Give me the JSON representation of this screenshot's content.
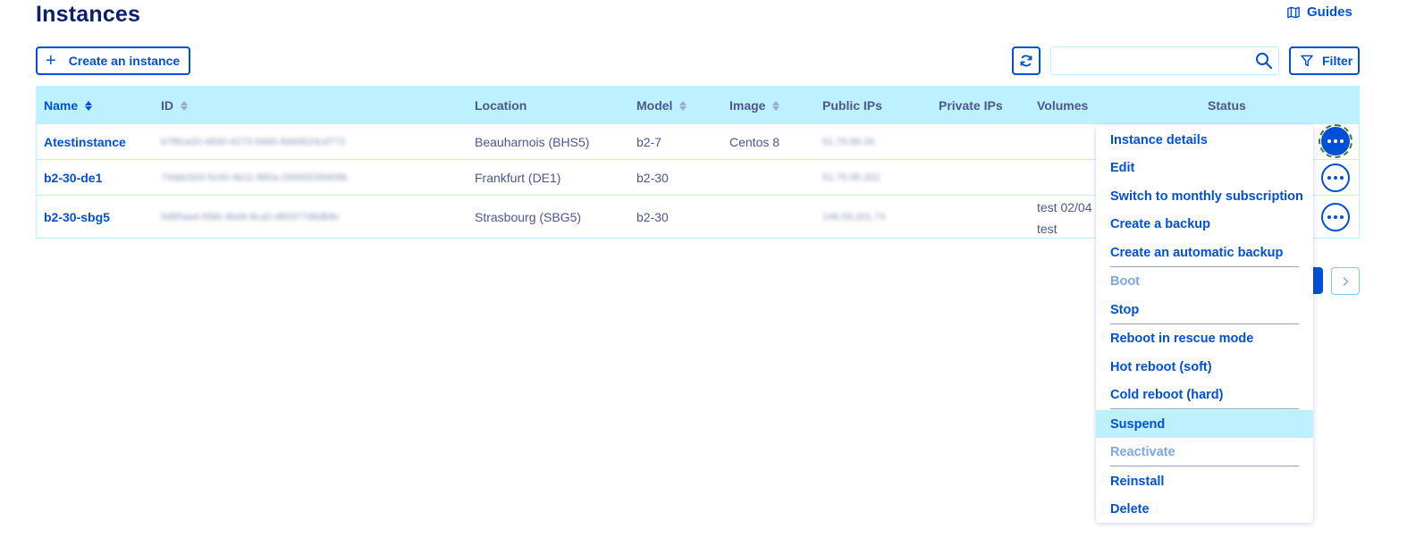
{
  "page": {
    "title": "Instances",
    "guides_label": "Guides"
  },
  "toolbar": {
    "create_label": "Create an instance",
    "search_placeholder": "",
    "filter_label": "Filter"
  },
  "table": {
    "columns": [
      "Name",
      "ID",
      "Location",
      "Model",
      "Image",
      "Public IPs",
      "Private IPs",
      "Volumes",
      "Status"
    ],
    "rows": [
      {
        "name": "Atestinstance",
        "id": "b7f8ca20-4830-4273-9466-8dd3624cd773",
        "location": "Beauharnois (BHS5)",
        "model": "b2-7",
        "image": "Centos 8",
        "public_ip": "51.79.86.34",
        "private_ip": "",
        "volumes": [
          "",
          ""
        ],
        "status": ""
      },
      {
        "name": "b2-30-de1",
        "id": "74ddc003-5c00-4b11-960a-26000539409b",
        "location": "Frankfurt (DE1)",
        "model": "b2-30",
        "image": "",
        "public_ip": "51.75.95.202",
        "private_ip": "",
        "volumes": [
          "",
          ""
        ],
        "status": ""
      },
      {
        "name": "b2-30-sbg5",
        "id": "5d85aa4-f0bb-4bd4-8ca0-d60377d6db8c",
        "location": "Strasbourg (SBG5)",
        "model": "b2-30",
        "image": "",
        "public_ip": "146.59.201.74",
        "private_ip": "",
        "volumes": [
          "test 02/04",
          "test"
        ],
        "status": ""
      }
    ]
  },
  "menu": {
    "items": [
      {
        "label": "Instance details",
        "state": "enabled"
      },
      {
        "label": "Edit",
        "state": "enabled"
      },
      {
        "label": "Switch to monthly subscription",
        "state": "enabled"
      },
      {
        "label": "Create a backup",
        "state": "enabled"
      },
      {
        "label": "Create an automatic backup",
        "state": "enabled"
      },
      {
        "label": "Boot",
        "state": "disabled"
      },
      {
        "label": "Stop",
        "state": "enabled"
      },
      {
        "label": "Reboot in rescue mode",
        "state": "enabled"
      },
      {
        "label": "Hot reboot (soft)",
        "state": "enabled"
      },
      {
        "label": "Cold reboot (hard)",
        "state": "enabled"
      },
      {
        "label": "Suspend",
        "state": "hover"
      },
      {
        "label": "Reactivate",
        "state": "disabled"
      },
      {
        "label": "Reinstall",
        "state": "enabled"
      },
      {
        "label": "Delete",
        "state": "enabled"
      }
    ]
  },
  "colors": {
    "accent": "#0050d7",
    "header_bg": "#bef1ff",
    "title": "#0b1f6b",
    "text": "#4d5592"
  },
  "icons": [
    "guides-book-icon",
    "plus-icon",
    "refresh-icon",
    "search-icon",
    "filter-icon",
    "sort-icon",
    "more-actions-icon",
    "chevron-right-icon"
  ]
}
